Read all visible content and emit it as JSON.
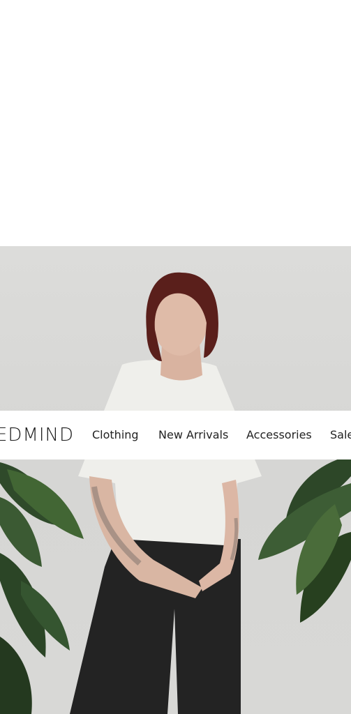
{
  "brand": {
    "logo_text": "EDMIND"
  },
  "nav": {
    "items": [
      {
        "label": "Clothing"
      },
      {
        "label": "New Arrivals"
      },
      {
        "label": "Accessories"
      },
      {
        "label": "Sale"
      }
    ]
  },
  "colors": {
    "background": "#ffffff",
    "hero_wall": "#d8d8d6",
    "text": "#222222"
  },
  "hero": {
    "image": "model-photo"
  }
}
